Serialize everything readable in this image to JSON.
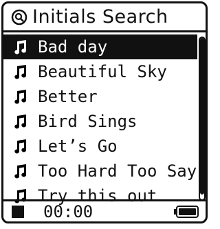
{
  "header": {
    "title": "Initials Search",
    "icon": "search-icon"
  },
  "songs": [
    {
      "label": "Bad day",
      "selected": true
    },
    {
      "label": "Beautiful Sky",
      "selected": false
    },
    {
      "label": "Better",
      "selected": false
    },
    {
      "label": "Bird Sings",
      "selected": false
    },
    {
      "label": "Let’s Go",
      "selected": false
    },
    {
      "label": "Too Hard Too Say",
      "selected": false
    },
    {
      "label": "Try this out",
      "selected": false
    }
  ],
  "scroll": {
    "visible_fraction": 0.97
  },
  "status": {
    "playback_icon": "stop-icon",
    "time": "00:00",
    "battery_icon": "battery-icon",
    "battery_level": 1.0
  }
}
